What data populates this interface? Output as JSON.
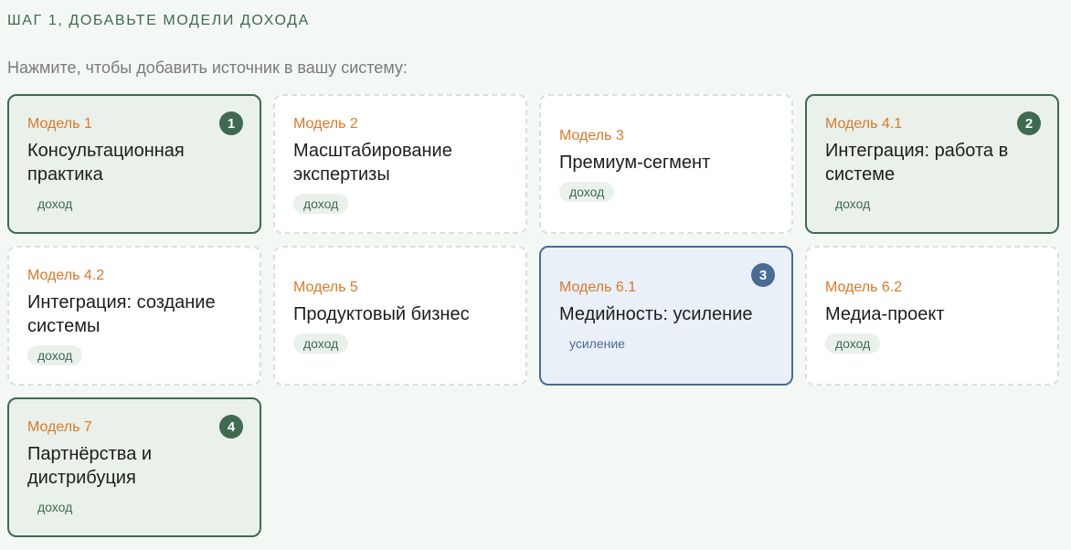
{
  "header": {
    "step_title": "ШАГ 1, ДОБАВЬТЕ МОДЕЛИ ДОХОДА",
    "subtitle": "Нажмите, чтобы добавить источник в вашу систему:"
  },
  "colors": {
    "accent_green": "#3f6a50",
    "accent_blue": "#4a6b96",
    "model_label": "#d9792a"
  },
  "cards": [
    {
      "label": "Модель 1",
      "name": "Консультационная практика",
      "tag": "доход",
      "selected": true,
      "order": "1",
      "state": "green"
    },
    {
      "label": "Модель 2",
      "name": "Масштабирование экспертизы",
      "tag": "доход",
      "selected": false,
      "order": "",
      "state": ""
    },
    {
      "label": "Модель 3",
      "name": "Премиум-сегмент",
      "tag": "доход",
      "selected": false,
      "order": "",
      "state": ""
    },
    {
      "label": "Модель 4.1",
      "name": "Интеграция: работа в системе",
      "tag": "доход",
      "selected": true,
      "order": "2",
      "state": "green"
    },
    {
      "label": "Модель 4.2",
      "name": "Интеграция: создание системы",
      "tag": "доход",
      "selected": false,
      "order": "",
      "state": ""
    },
    {
      "label": "Модель 5",
      "name": "Продуктовый бизнес",
      "tag": "доход",
      "selected": false,
      "order": "",
      "state": ""
    },
    {
      "label": "Модель 6.1",
      "name": "Медийность: усиление",
      "tag": "усиление",
      "selected": true,
      "order": "3",
      "state": "blue"
    },
    {
      "label": "Модель 6.2",
      "name": "Медиа-проект",
      "tag": "доход",
      "selected": false,
      "order": "",
      "state": ""
    },
    {
      "label": "Модель 7",
      "name": "Партнёрства и дистрибуция",
      "tag": "доход",
      "selected": true,
      "order": "4",
      "state": "green"
    }
  ]
}
